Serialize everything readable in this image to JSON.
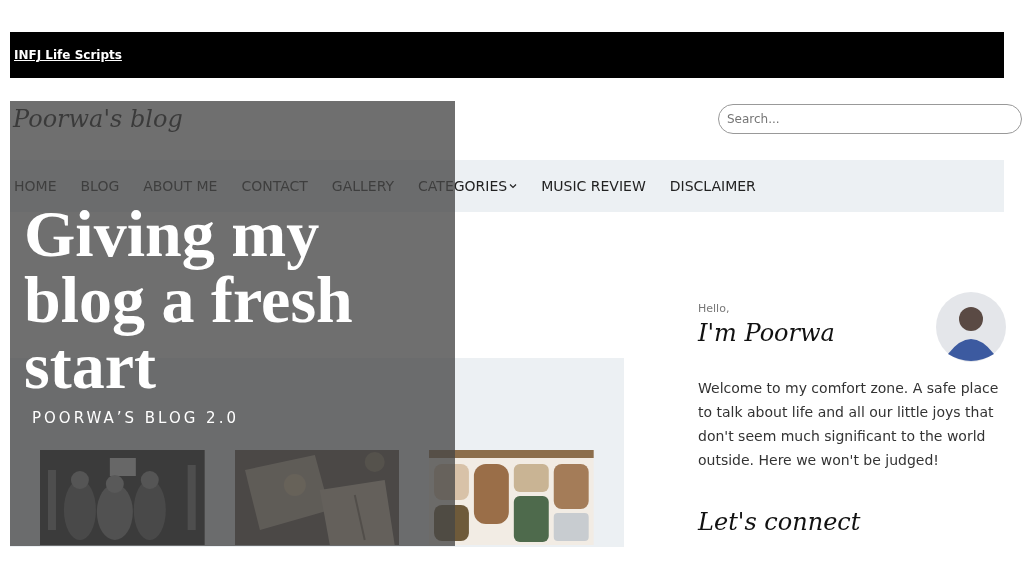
{
  "top_bar": {
    "link": "INFJ Life Scripts"
  },
  "header": {
    "site_title": "Poorwa's blog",
    "search": {
      "placeholder": "Search..."
    }
  },
  "nav": [
    {
      "label": "HOME",
      "has_dropdown": false
    },
    {
      "label": "BLOG",
      "has_dropdown": false
    },
    {
      "label": "ABOUT ME",
      "has_dropdown": false
    },
    {
      "label": "CONTACT",
      "has_dropdown": false
    },
    {
      "label": "GALLERY",
      "has_dropdown": false
    },
    {
      "label": "CATEGORIES",
      "has_dropdown": true
    },
    {
      "label": "MUSIC REVIEW",
      "has_dropdown": false
    },
    {
      "label": "DISCLAIMER",
      "has_dropdown": false
    }
  ],
  "sidebar": {
    "greeting": "Hello,",
    "name": "I'm Poorwa",
    "intro": "Welcome to my comfort zone. A safe place to talk about life and all our little joys that don't seem much significant to the world outside. Here we won't be judged!",
    "connect_heading": "Let's connect"
  },
  "overlay": {
    "title": "Giving my blog a fresh start",
    "subtitle": "POORWA’S BLOG 2.0"
  }
}
